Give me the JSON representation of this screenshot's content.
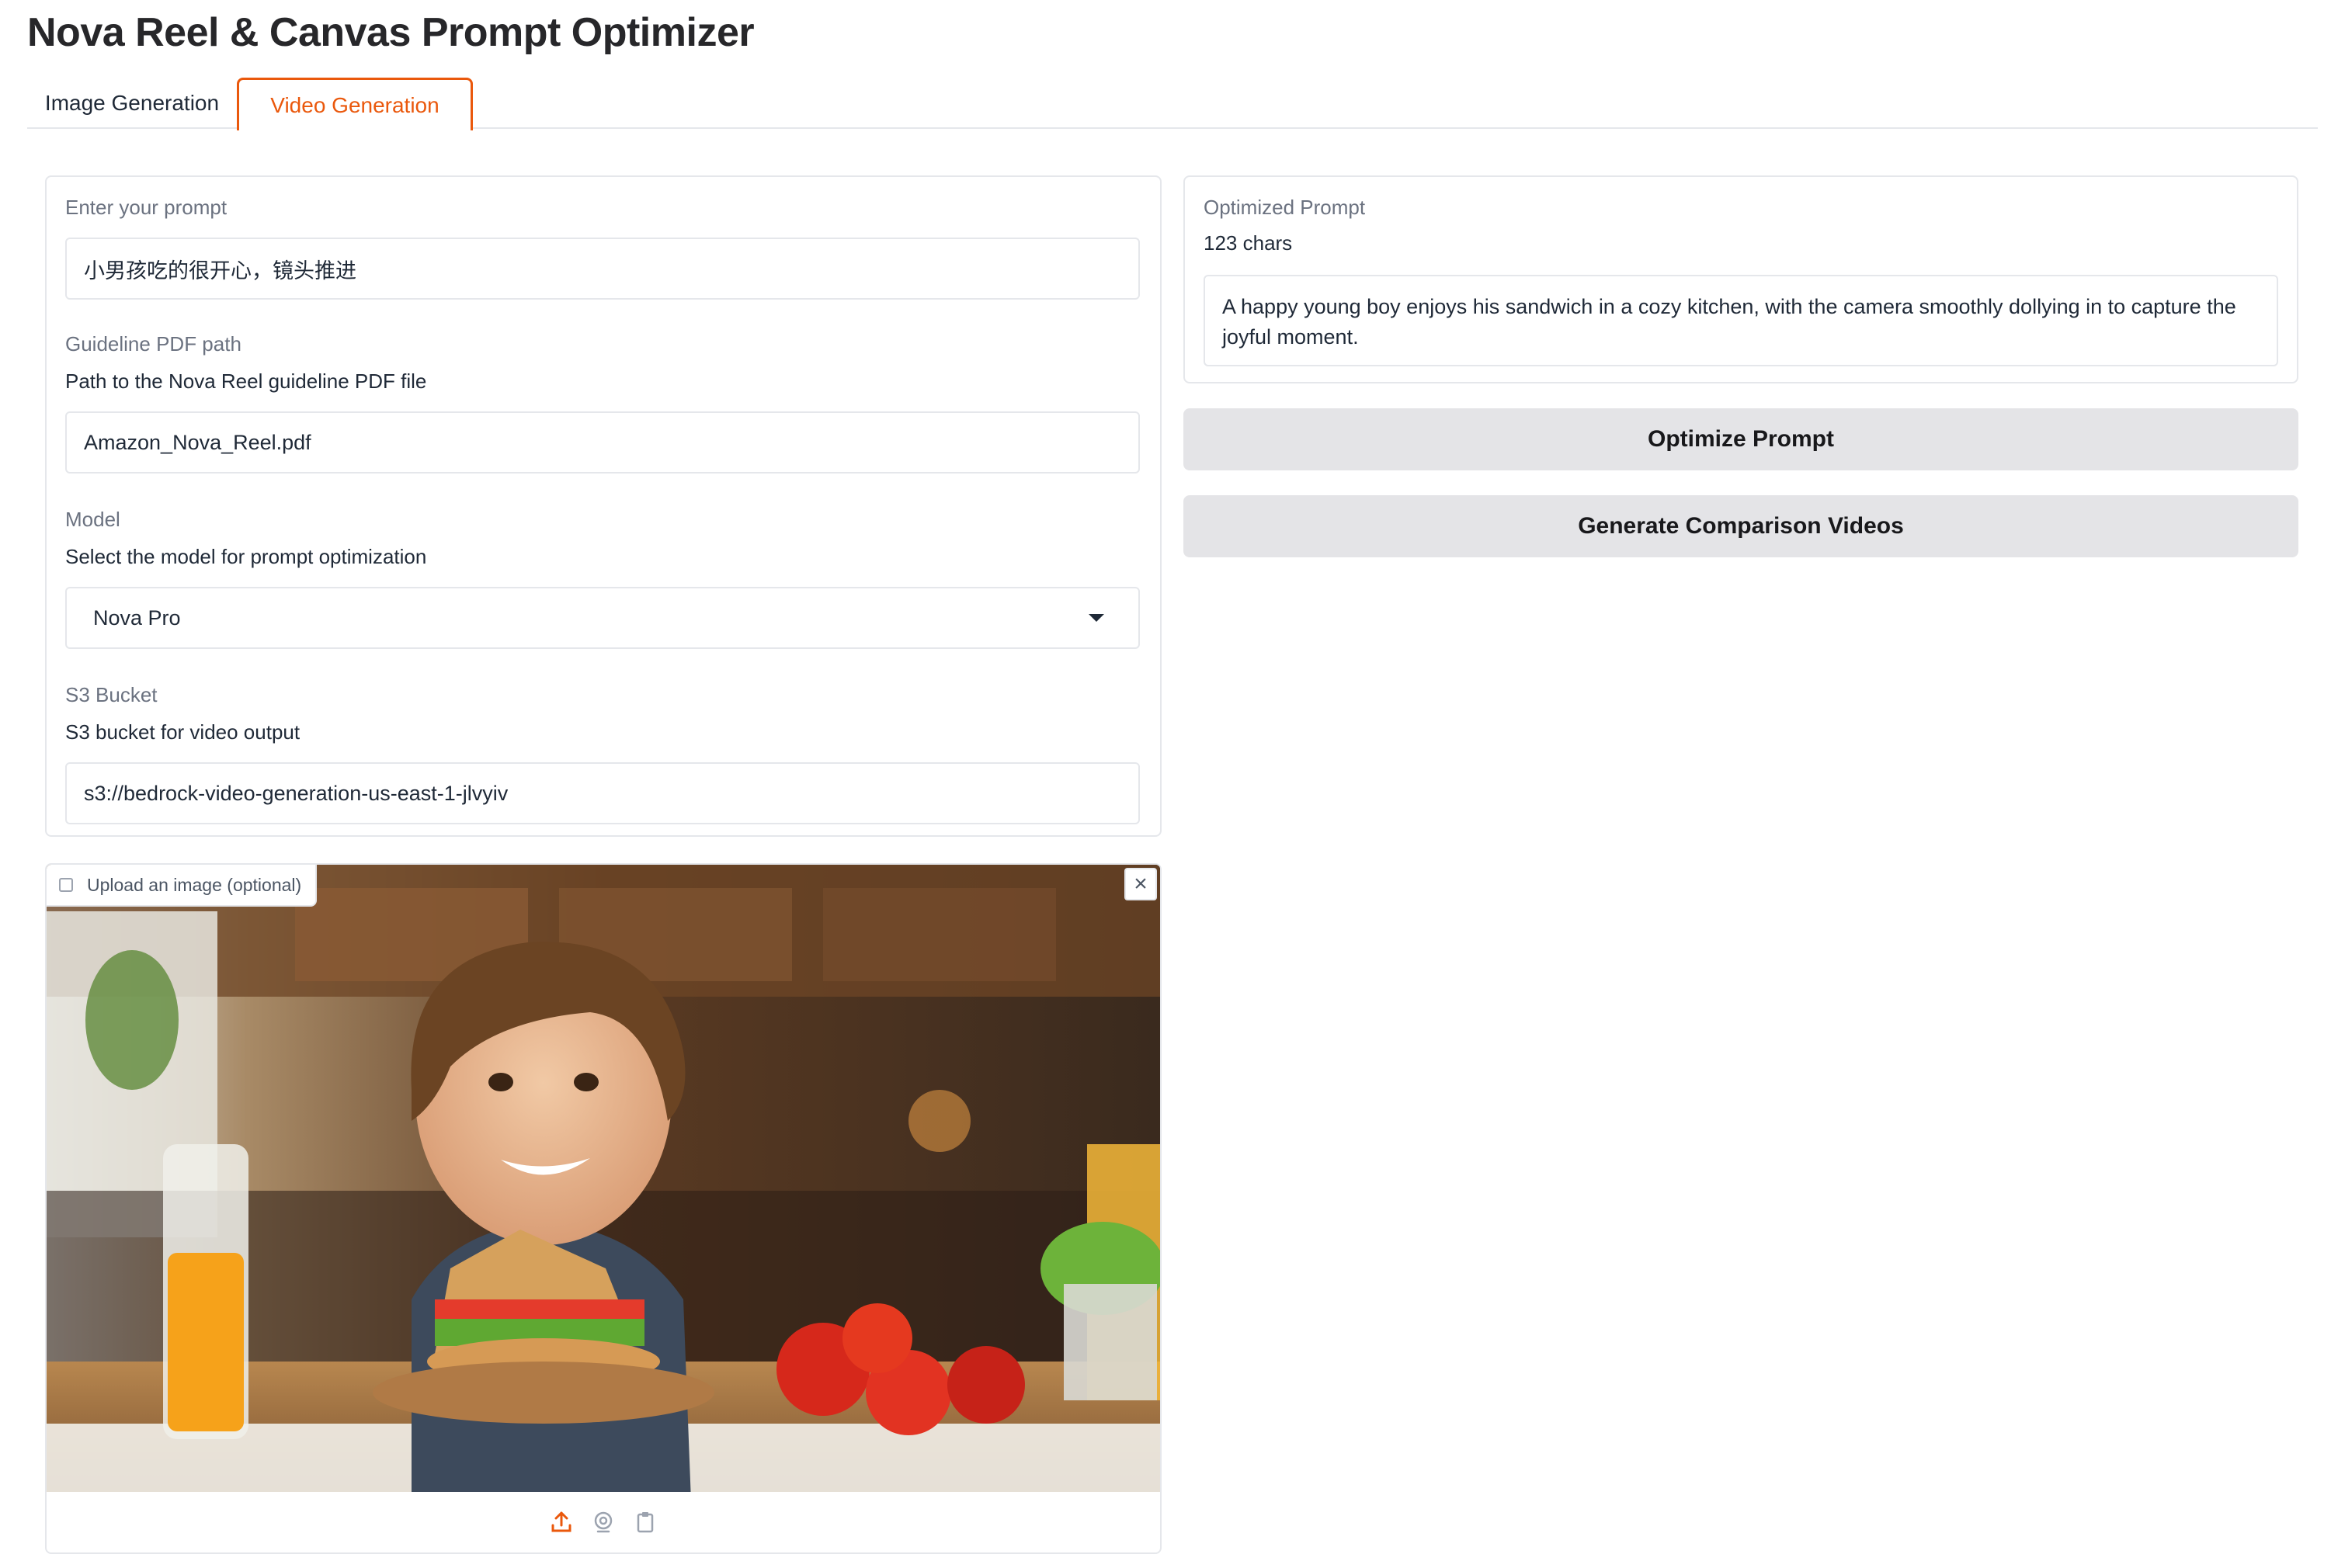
{
  "app": {
    "title": "Nova Reel & Canvas Prompt Optimizer"
  },
  "tabs": [
    {
      "label": "Image Generation",
      "active": false
    },
    {
      "label": "Video Generation",
      "active": true
    }
  ],
  "form": {
    "prompt": {
      "label": "Enter your prompt",
      "value": "小男孩吃的很开心，镜头推进"
    },
    "guideline": {
      "label": "Guideline PDF path",
      "info": "Path to the Nova Reel guideline PDF file",
      "value": "Amazon_Nova_Reel.pdf"
    },
    "model": {
      "label": "Model",
      "info": "Select the model for prompt optimization",
      "value": "Nova Pro"
    },
    "bucket": {
      "label": "S3 Bucket",
      "info": "S3 bucket for video output",
      "value": "s3://bedrock-video-generation-us-east-1-jlvyiv"
    }
  },
  "image_upload": {
    "label": "Upload an image (optional)"
  },
  "optimized": {
    "label": "Optimized Prompt",
    "chars": "123 chars",
    "text": "A happy young boy enjoys his sandwich in a cozy kitchen, with the camera smoothly dollying in to capture the joyful moment."
  },
  "buttons": {
    "optimize": "Optimize Prompt",
    "generate": "Generate Comparison Videos"
  },
  "colors": {
    "accent": "#ea580c",
    "button_bg": "#e4e4e7",
    "border": "#e5e7eb"
  },
  "icons": [
    "upload-icon",
    "webcam-icon",
    "clipboard-icon",
    "close-icon",
    "image-icon",
    "chevron-down-icon"
  ]
}
